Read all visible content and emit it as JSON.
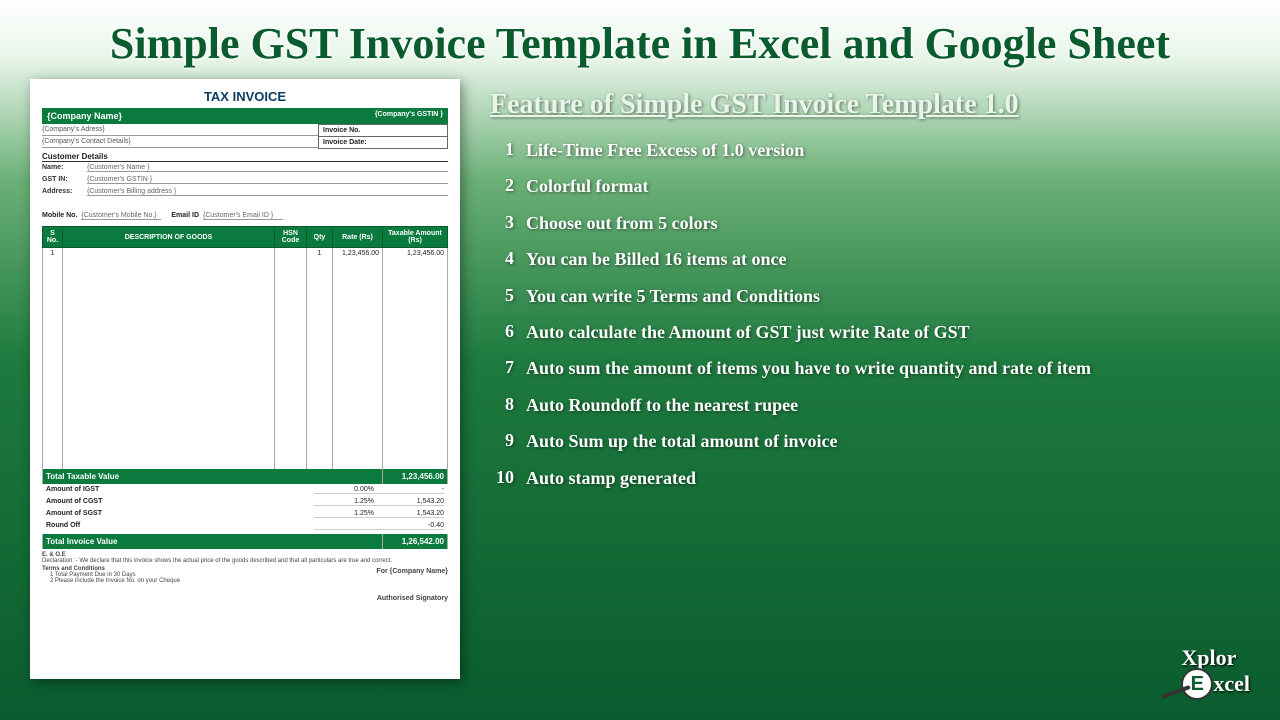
{
  "title": "Simple GST Invoice Template in Excel and Google Sheet",
  "features_heading": "Feature of Simple GST Invoice Template 1.0",
  "features": [
    "Life-Time Free Excess of 1.0 version",
    "Colorful format",
    "Choose out from 5 colors",
    "You can be Billed 16 items at once",
    "You can write 5 Terms and Conditions",
    "Auto calculate the Amount of GST just write Rate of GST",
    "Auto sum the amount of items you have to write quantity and rate of item",
    "Auto Roundoff to the nearest rupee",
    "Auto Sum up the total amount of invoice",
    "Auto stamp generated"
  ],
  "invoice": {
    "doc_title": "TAX INVOICE",
    "company_name": "{Company Name}",
    "company_gstin": "{Company's GSTIN }",
    "company_address": "{Company's Adress}",
    "company_contact": "{Company's Contact Details}",
    "invoice_no_label": "Invoice No.",
    "invoice_date_label": "Invoice Date:",
    "customer_details_label": "Customer Details",
    "name_label": "Name:",
    "gstin_label": "GST IN:",
    "address_label": "Address:",
    "mobile_label": "Mobile No.",
    "email_label": "Email ID",
    "customer_name": "{Customer's Name }",
    "customer_gstin": "{Customer's GSTIN }",
    "customer_address": "{Customer's Billing address }",
    "customer_mobile": "{Customer's Mobile No.}",
    "customer_email": "{Customer's Email ID }",
    "col_sno": "S No.",
    "col_desc": "DESCRIPTION OF GOODS",
    "col_hsn": "HSN Code",
    "col_qty": "Qty",
    "col_rate": "Rate (Rs)",
    "col_amount": "Taxable Amount (Rs)",
    "row1_sno": "1",
    "row1_qty": "1",
    "row1_rate": "1,23,456.00",
    "row1_amount": "1,23,456.00",
    "total_taxable_label": "Total Taxable Value",
    "total_taxable_value": "1,23,456.00",
    "igst_label": "Amount of IGST",
    "igst_pct": "0.00%",
    "igst_amt": "-",
    "cgst_label": "Amount of CGST",
    "cgst_pct": "1.25%",
    "cgst_amt": "1,543.20",
    "sgst_label": "Amount of SGST",
    "sgst_pct": "1.25%",
    "sgst_amt": "1,543.20",
    "roundoff_label": "Round Off",
    "roundoff_amt": "-0.40",
    "total_invoice_label": "Total Invoice Value",
    "total_invoice_value": "1,26,542.00",
    "eoe": "E. & O.E",
    "declaration": "Declaration :- We declare that this invoice shows the actual price of the goods described and that all particulars are true and correct.",
    "terms_label": "Terms and Conditions",
    "term1": "1  Total Payment Due in 30 Days",
    "term2": "2  Please include the Invoice No. on your Cheque",
    "for_label": "For {Company Name}",
    "signatory": "Authorised Signatory"
  },
  "logo": {
    "line1": "Xplor",
    "line2": "xcel",
    "e": "E"
  }
}
